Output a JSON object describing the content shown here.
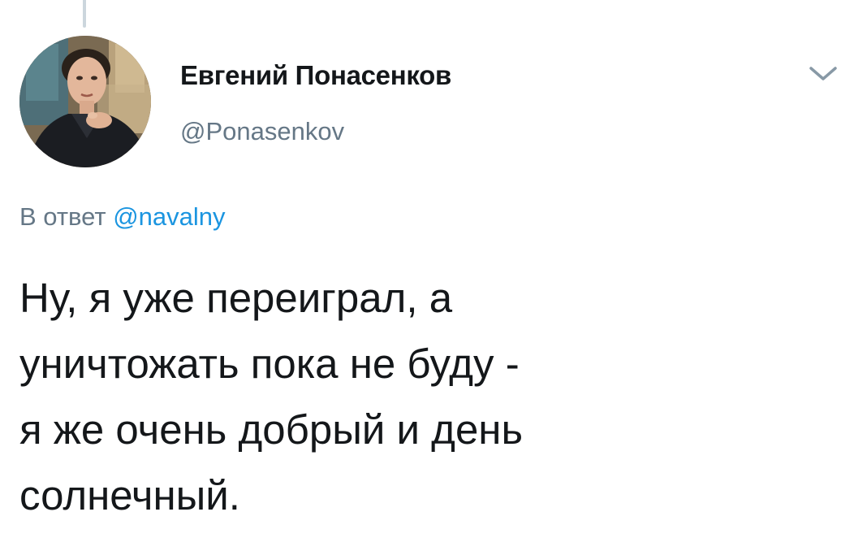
{
  "tweet": {
    "author": {
      "display_name": "Евгений Понасенков",
      "handle": "@Ponasenkov",
      "avatar_icon": "profile-photo"
    },
    "reply_to": {
      "prefix": "В ответ",
      "mention": "@navalny"
    },
    "text_lines": [
      "Ну, я уже переиграл, а",
      "уничтожать пока не буду -",
      "я же очень добрый и день",
      "солнечный."
    ],
    "menu_icon": "chevron-down-icon"
  },
  "colors": {
    "text_primary": "#14171a",
    "text_secondary": "#657786",
    "link": "#1b95e0",
    "thread_line": "#ccd6dd"
  }
}
